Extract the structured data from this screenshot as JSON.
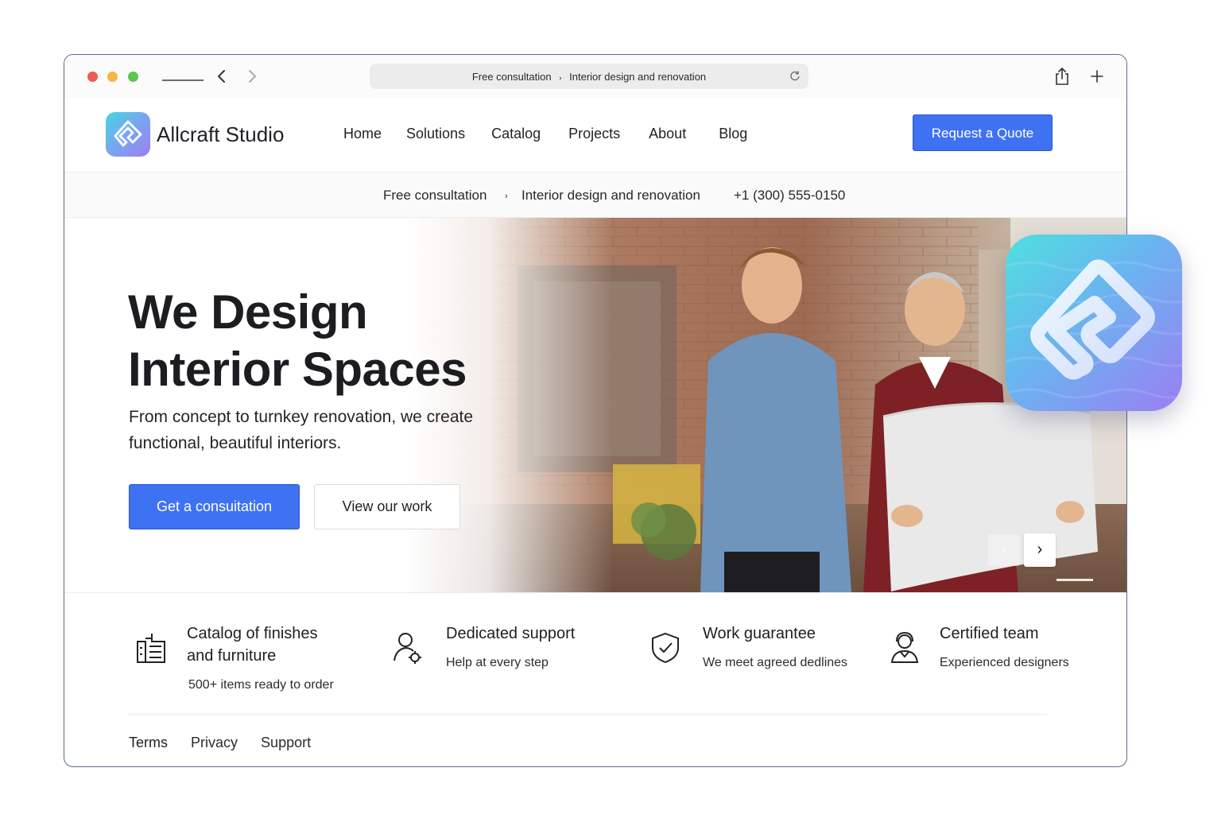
{
  "browser": {
    "url_part1": "Free consultation",
    "url_sep": "›",
    "url_part2": "Interior design and renovation"
  },
  "header": {
    "brand": "Allcraft Studio",
    "nav": [
      "Home",
      "Solutions",
      "Catalog",
      "Projects",
      "About",
      "Blog"
    ],
    "cta": "Request a Quote"
  },
  "info_strip": {
    "item1": "Free consultation",
    "sep": "›",
    "item2": "Interior design and renovation",
    "phone": "+1 (300) 555-0150"
  },
  "hero": {
    "title_line1": "We Design",
    "title_line2": "Interior Spaces",
    "subtitle": "From concept to turnkey renovation, we create functional, beautiful interiors.",
    "primary_button": "Get a consuitation",
    "secondary_button": "View our work",
    "prev_glyph": "‹",
    "next_glyph": "›"
  },
  "features": [
    {
      "title": "Catalog of finishes\nand furniture",
      "title_line1": "Catalog of finishes",
      "title_line2": "and furniture",
      "desc": "500+ items ready to order",
      "icon": "catalog-icon"
    },
    {
      "title": "Dedicated support",
      "desc": "Help at every step",
      "icon": "support-person-gear-icon"
    },
    {
      "title": "Work guarantee",
      "desc": "We meet agreed dedlines",
      "icon": "shield-check-icon"
    },
    {
      "title": "Certified team",
      "desc": "Experienced designers",
      "icon": "headset-person-icon"
    }
  ],
  "footer": {
    "links": [
      "Terms",
      "Privacy",
      "Support"
    ]
  },
  "colors": {
    "accent": "#3f72f3",
    "brand_gradient_start": "#44d6e0",
    "brand_gradient_end": "#9b7ff0"
  }
}
